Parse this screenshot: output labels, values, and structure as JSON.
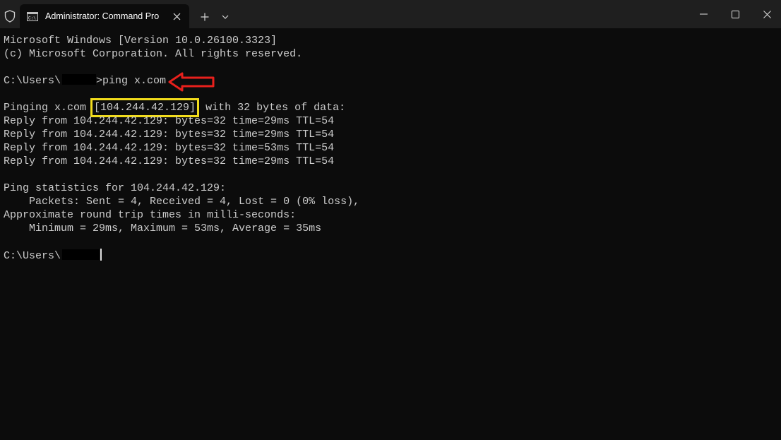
{
  "window": {
    "tab_title": "Administrator: Command Pro",
    "icons": {
      "shield": "shield-icon",
      "cmd": "cmd-icon",
      "close_tab": "close-icon",
      "new_tab": "plus-icon",
      "dropdown": "chevron-down-icon",
      "minimize": "minimize-icon",
      "maximize": "maximize-icon",
      "close_window": "close-icon"
    }
  },
  "colors": {
    "background": "#0c0c0c",
    "titlebar": "#1f1f1f",
    "text": "#cccccc",
    "highlight_box": "#f2dc1c",
    "annotation_arrow": "#e8201c"
  },
  "terminal": {
    "header_line1": "Microsoft Windows [Version 10.0.26100.3323]",
    "header_line2": "(c) Microsoft Corporation. All rights reserved.",
    "prompt_prefix": "C:\\Users\\",
    "command": ">ping x.com",
    "pinging_prefix": "Pinging x.com ",
    "pinging_ip": "[104.244.42.129]",
    "pinging_suffix": " with 32 bytes of data:",
    "replies": [
      "Reply from 104.244.42.129: bytes=32 time=29ms TTL=54",
      "Reply from 104.244.42.129: bytes=32 time=29ms TTL=54",
      "Reply from 104.244.42.129: bytes=32 time=53ms TTL=54",
      "Reply from 104.244.42.129: bytes=32 time=29ms TTL=54"
    ],
    "stats_title": "Ping statistics for 104.244.42.129:",
    "stats_packets": "    Packets: Sent = 4, Received = 4, Lost = 0 (0% loss),",
    "stats_rtt_title": "Approximate round trip times in milli-seconds:",
    "stats_rtt": "    Minimum = 29ms, Maximum = 53ms, Average = 35ms",
    "final_prompt_prefix": "C:\\Users\\"
  }
}
